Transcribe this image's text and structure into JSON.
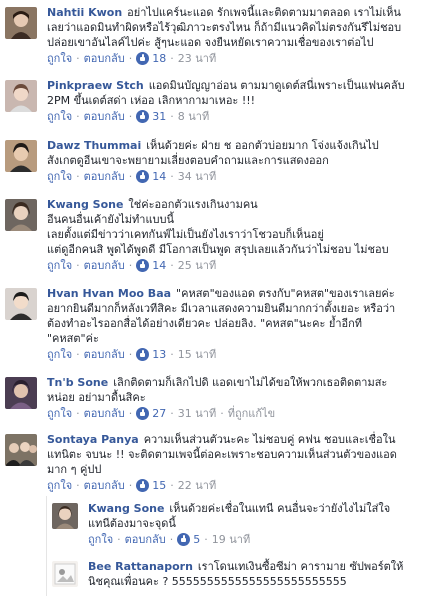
{
  "comments": [
    {
      "name": "Nahtii Kwon",
      "lines": [
        "อย่าไปแคร์นะแอด รักเพจนี้และติดตามมาตลอด เราไม่เห็น",
        "เลยว่าแอดมินทำผิดหรือไร้วุฒิภาวะตรงไหน ก็ถ้ามีแนวคิดไม่ตรงกันรึไม่ชอบ",
        "ปล่อยเขาอันไลค์ไปค่ะ สู้ๆนะแอด จงยืนหยัดเราความเชื่อของเราต่อไป"
      ],
      "action_like": "ถูกใจ",
      "action_reply": "ตอบกลับ",
      "likes": "18",
      "time": "23 นาที",
      "extra": ""
    },
    {
      "name": "Pinkpraew Stch",
      "lines": [
        "แอดมินบัญญาอ่อน ตามมาดูเดต์สนี่เพราะเป็นแฟนคลับ",
        "2PM ขึ้นเดต์สด่า เห่ออ เลิกหากามาเหอะ !!!"
      ],
      "action_like": "ถูกใจ",
      "action_reply": "ตอบกลับ",
      "likes": "31",
      "time": "8 นาที",
      "extra": ""
    },
    {
      "name": "Dawz Thummai",
      "lines": [
        "เห็นด้วยค่ะ ฝ่าย ช ออกตัวบ่อยมาก โจ่งแจ้งเกินไป",
        "สังเกตดูอีนเขาจะพยายามเลี่ยงตอบคำถามและการแสดงออก"
      ],
      "action_like": "ถูกใจ",
      "action_reply": "ตอบกลับ",
      "likes": "14",
      "time": "34 นาที",
      "extra": ""
    },
    {
      "name": "Kwang Sone",
      "lines": [
        "ใช่ค่ะออกตัวแรงเกินงามคน",
        "อีนคนอื่นเค้ายังไม่ทำแบบนี้",
        "เลยตั้งแต่มีข่าวว่าเคทกันฟ์ไม่เป็นยังไงเราว่าโชวอบก็เห็นอยู่",
        "แต่ดูอีกคนสิ พูดได้พูดดี มีโอกาสเป็นพูด สรุปเลยแล้วกันว่าไม่ชอบ ไม่ชอบ"
      ],
      "action_like": "ถูกใจ",
      "action_reply": "ตอบกลับ",
      "likes": "14",
      "time": "25 นาที",
      "extra": ""
    },
    {
      "name": "Hvan Hvan Moo Baa",
      "lines": [
        "\"คหสต\"ของแอด ตรงกับ\"คหสต\"ของเราเลยค่ะ",
        "อยากยินดีมากก็หลังเวทีสิคะ มีเวลาแสดงความยินดีมากกว่าตั้งเยอะ หรือว่า",
        "ต้องทำอะไรออกสื่อได้อย่างเดียวคะ ปล่อยลิง. \"คหสต\"นะคะ ย้ำอีกที",
        "\"คหสต\"ค่ะ"
      ],
      "action_like": "ถูกใจ",
      "action_reply": "ตอบกลับ",
      "likes": "13",
      "time": "15 นาที",
      "extra": ""
    },
    {
      "name": "Tn'b Sone",
      "lines": [
        "เลิกติดตามก็เลิกไปดิ แอดเขาไม่ได้ขอให้พวกเธอติดตามสะ",
        "หน่อย อย่ามาดื้นสิคะ"
      ],
      "action_like": "ถูกใจ",
      "action_reply": "ตอบกลับ",
      "likes": "27",
      "time": "31 นาที",
      "extra": "ที่ถูกแก้ไข"
    },
    {
      "name": "Sontaya Panya",
      "lines": [
        "ความเห็นส่วนตัวนะคะ ไม่ชอบคู่ คฟน ชอบและเชื่อใน",
        "แทนิตะ จบนะ !! จะติดตามเพจนี้ต่อคะเพราะชอบความเห็นส่วนตัวของแอด",
        "มาก ๆ คู่ปป"
      ],
      "action_like": "ถูกใจ",
      "action_reply": "ตอบกลับ",
      "likes": "15",
      "time": "22 นาที",
      "extra": ""
    }
  ],
  "replies": [
    {
      "name": "Kwang Sone",
      "lines": [
        "เห็นด้วยค่ะเชื่อในแทนี คนอื่นจะว่ายังไงไม่ใส่ใจ",
        "แทนีต้องมาจะจุดนี้"
      ],
      "action_like": "ถูกใจ",
      "action_reply": "ตอบกลับ",
      "likes": "5",
      "time": "19 นาที",
      "extra": ""
    },
    {
      "name": "Bee Rattanaporn",
      "lines": [
        "เราโดนเทเงินซื้อซีม่า คารามาย ซัปพอร์ตให้",
        "นิชคุณเพื่อนคะ ? 5555555555555555555555555"
      ],
      "action_like": "",
      "action_reply": "",
      "likes": "",
      "time": "",
      "extra": ""
    }
  ]
}
